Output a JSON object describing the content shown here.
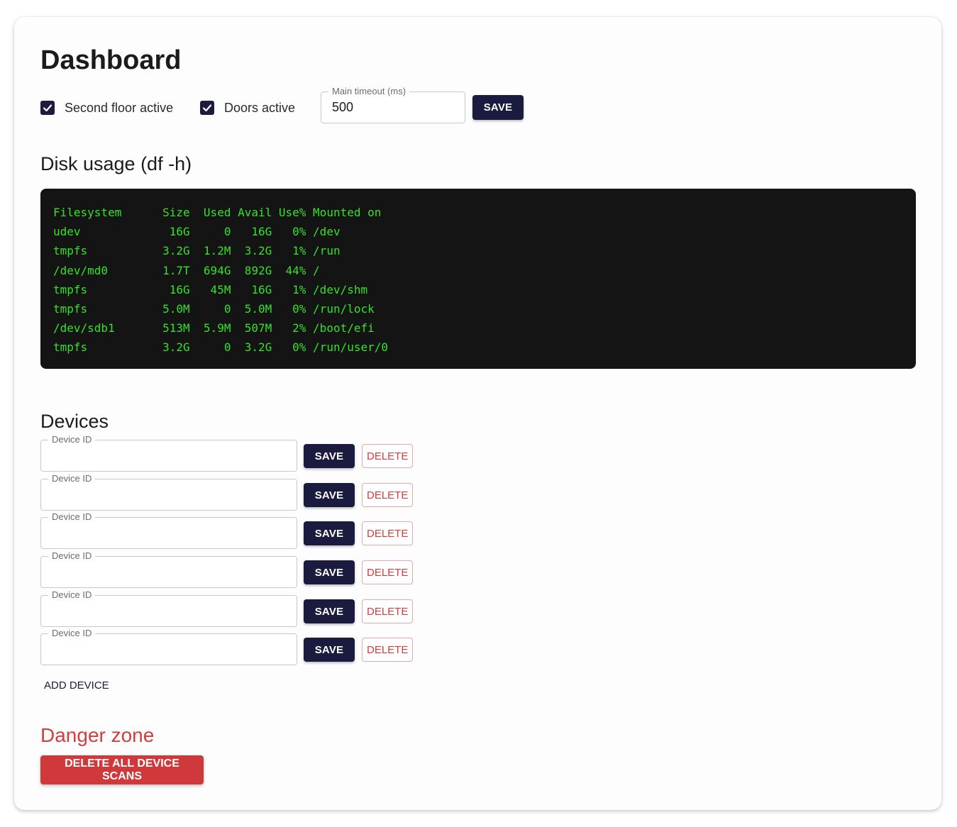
{
  "header": {
    "title": "Dashboard"
  },
  "settings": {
    "second_floor": {
      "label": "Second floor active",
      "checked": true
    },
    "doors": {
      "label": "Doors active",
      "checked": true
    },
    "timeout": {
      "label": "Main timeout (ms)",
      "value": "500"
    },
    "save_label": "SAVE"
  },
  "disk": {
    "title": "Disk usage (df -h)",
    "lines": [
      "Filesystem      Size  Used Avail Use% Mounted on",
      "udev             16G     0   16G   0% /dev",
      "tmpfs           3.2G  1.2M  3.2G   1% /run",
      "/dev/md0        1.7T  694G  892G  44% /",
      "tmpfs            16G   45M   16G   1% /dev/shm",
      "tmpfs           5.0M     0  5.0M   0% /run/lock",
      "/dev/sdb1       513M  5.9M  507M   2% /boot/efi",
      "tmpfs           3.2G     0  3.2G   0% /run/user/0"
    ]
  },
  "devices": {
    "title": "Devices",
    "field_label": "Device ID",
    "save_label": "SAVE",
    "delete_label": "DELETE",
    "add_label": "ADD DEVICE",
    "items": [
      {
        "value": ""
      },
      {
        "value": ""
      },
      {
        "value": ""
      },
      {
        "value": ""
      },
      {
        "value": ""
      },
      {
        "value": ""
      }
    ]
  },
  "danger": {
    "title": "Danger zone",
    "button_label": "DELETE ALL DEVICE SCANS"
  },
  "colors": {
    "primary": "#1b1a3f",
    "danger": "#d0393b",
    "terminal_bg": "#141414",
    "terminal_text": "#34e12a"
  }
}
